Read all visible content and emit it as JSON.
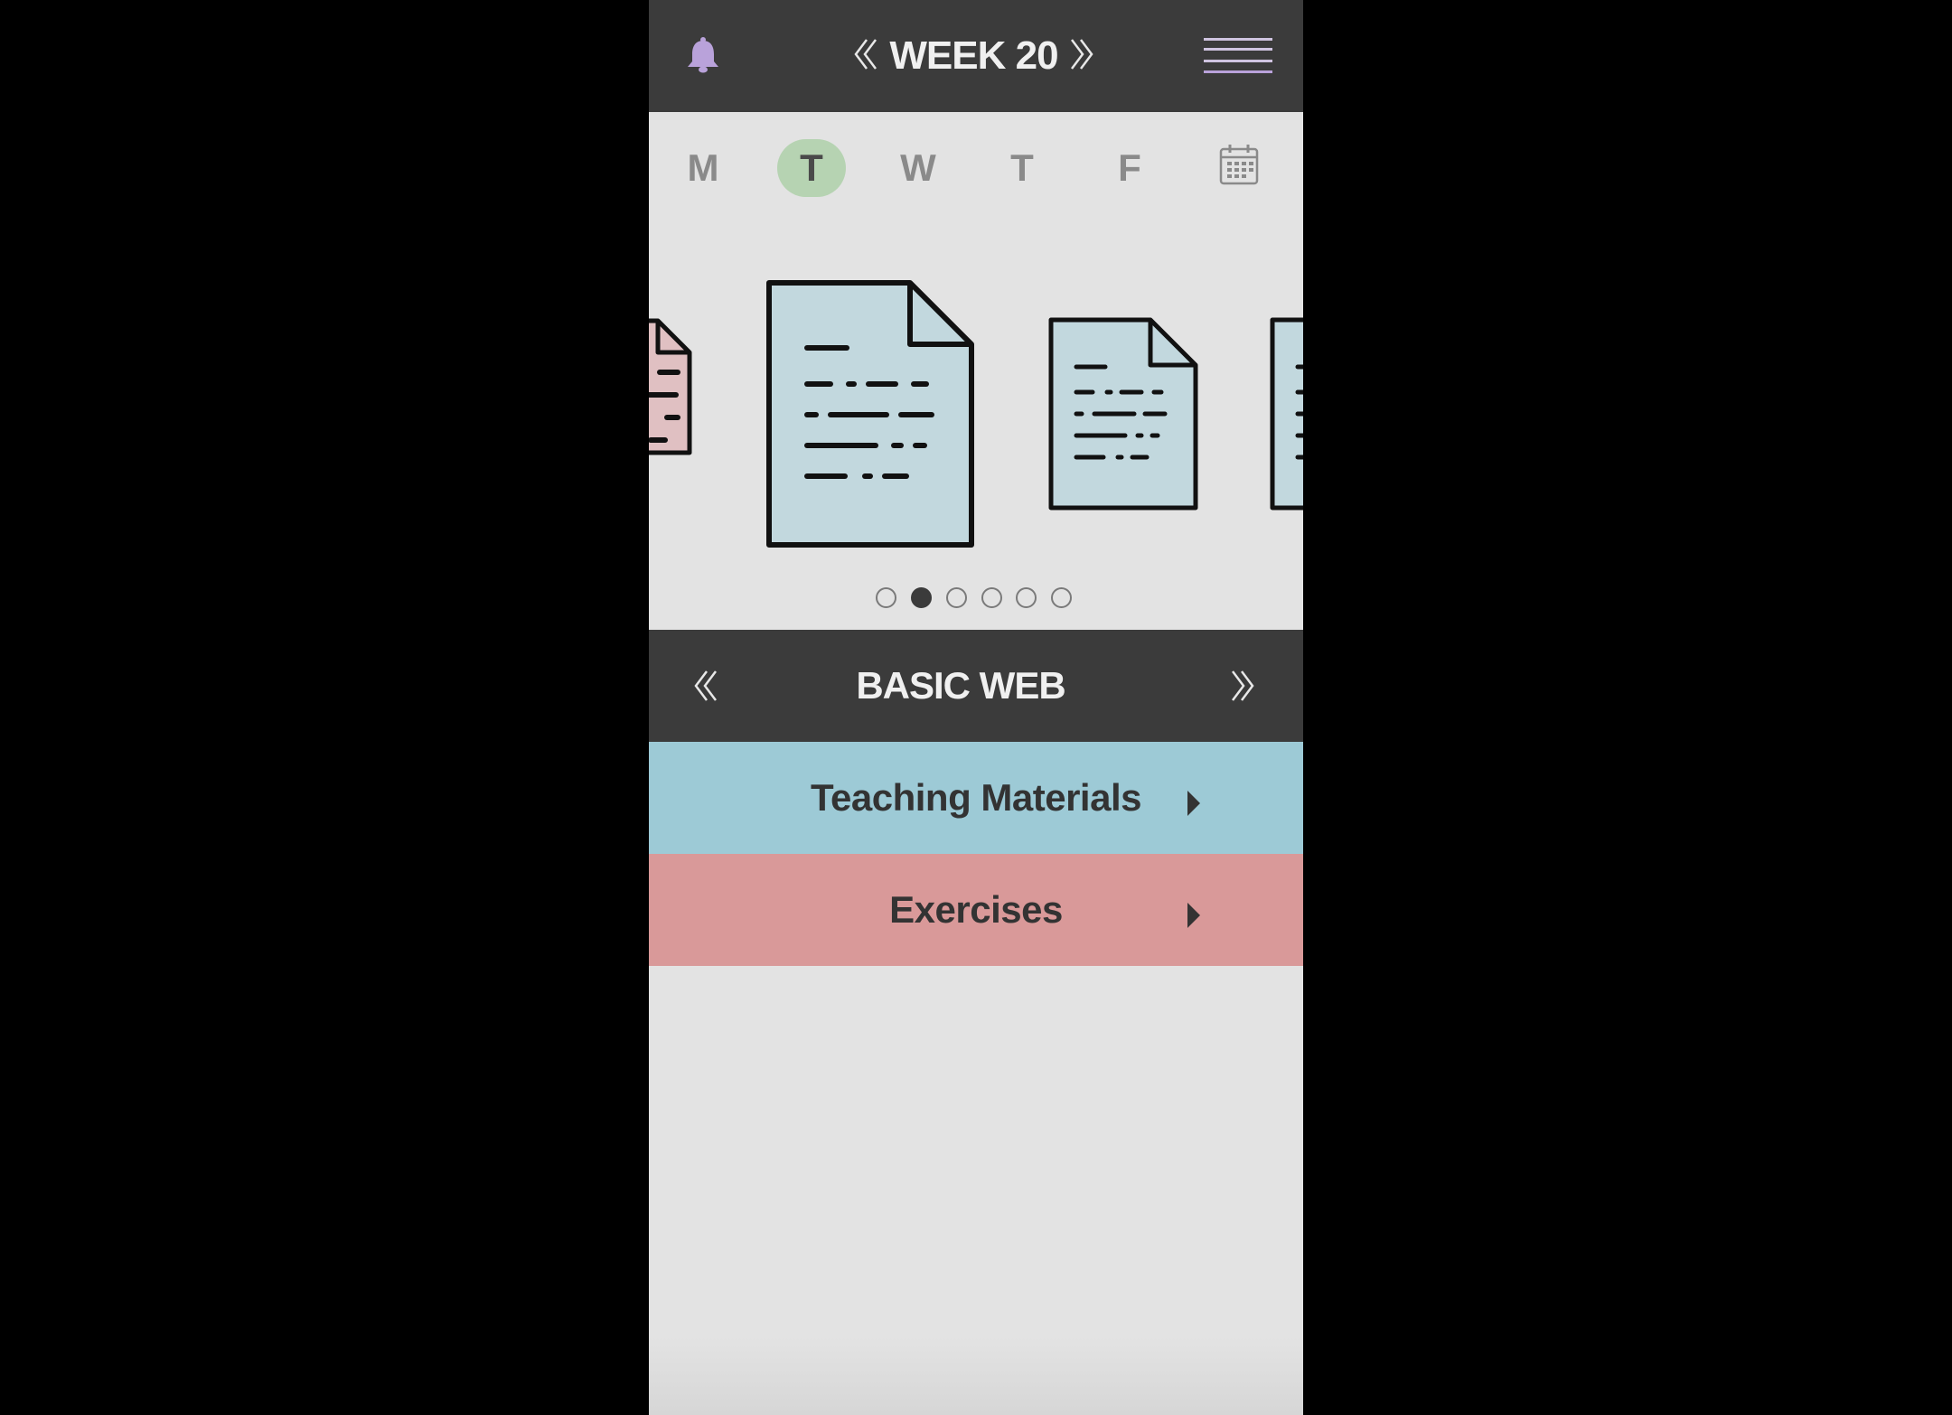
{
  "header": {
    "week_title": "WEEK 20",
    "icons": {
      "notifications": "bell-icon",
      "prev_week": "double-chevron-left-icon",
      "next_week": "double-chevron-right-icon",
      "menu": "hamburger-menu-icon"
    }
  },
  "days": {
    "items": [
      {
        "label": "M",
        "active": false
      },
      {
        "label": "T",
        "active": true
      },
      {
        "label": "W",
        "active": false
      },
      {
        "label": "T",
        "active": false
      },
      {
        "label": "F",
        "active": false
      }
    ],
    "calendar_icon": "calendar-icon"
  },
  "carousel": {
    "slide_count": 6,
    "active_index": 1
  },
  "course": {
    "title": "BASIC WEB"
  },
  "sections": [
    {
      "label": "Teaching Materials",
      "color": "#9dcad6"
    },
    {
      "label": "Exercises",
      "color": "#d99999"
    }
  ],
  "colors": {
    "header_bg": "#3b3b3b",
    "active_day": "#b6d3b2",
    "doc_blue": "#c2d8de",
    "doc_pink": "#e0c0c2",
    "bell": "#b9a2da"
  }
}
